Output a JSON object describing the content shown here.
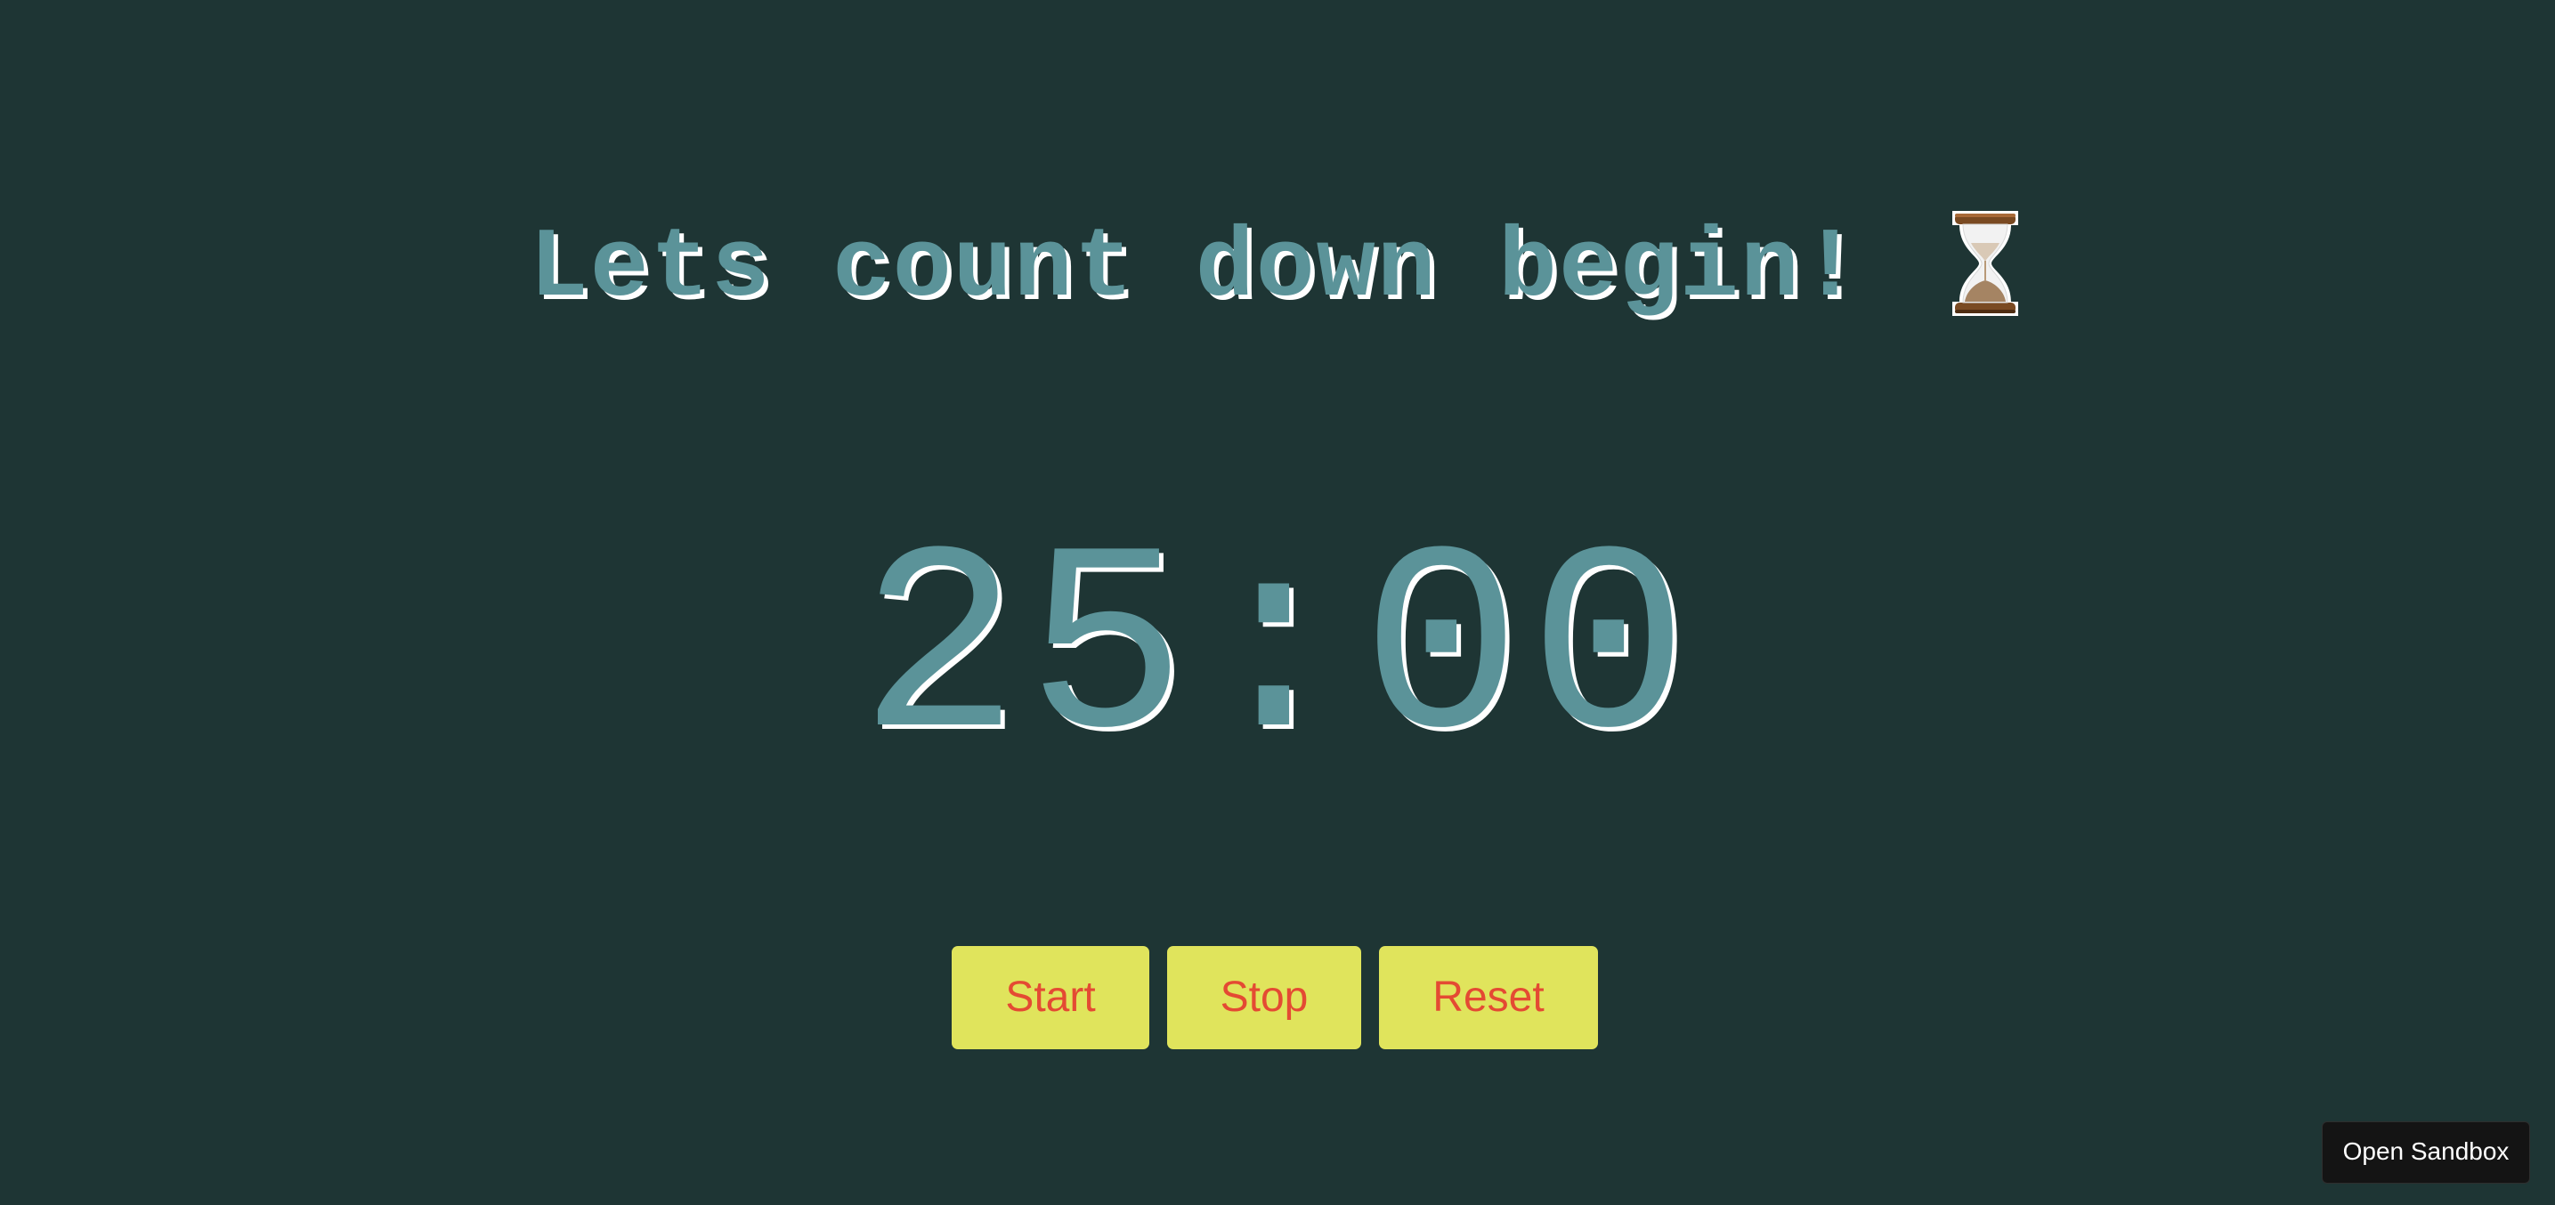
{
  "header": {
    "title": "Lets count down begin!",
    "icon": "hourglass-icon"
  },
  "timer": {
    "display": "25:00"
  },
  "controls": {
    "start_label": "Start",
    "stop_label": "Stop",
    "reset_label": "Reset"
  },
  "footer": {
    "open_sandbox_label": "Open Sandbox"
  },
  "colors": {
    "background": "#1e3534",
    "text_teal": "#5b9399",
    "button_yellow": "#e0e45c",
    "button_text_red": "#e44a33",
    "sandbox_button": "#141414"
  }
}
